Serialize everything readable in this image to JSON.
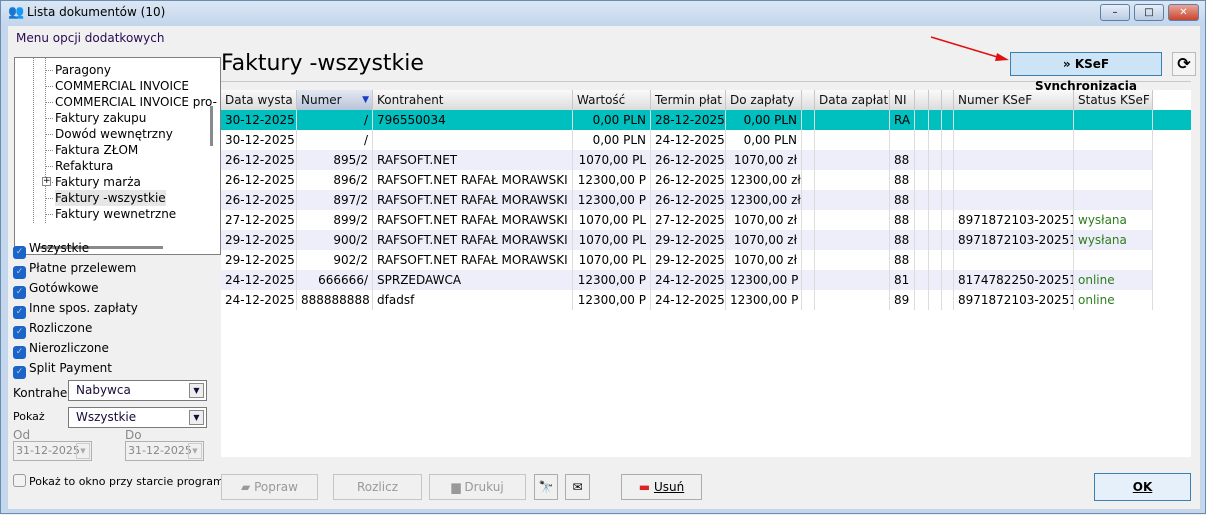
{
  "window": {
    "title": "Lista dokumentów (10)",
    "minimize": "–",
    "maximize": "□",
    "close": "✕"
  },
  "menu": "Menu opcji dodatkowych",
  "tree": {
    "items": [
      "Paragony",
      "COMMERCIAL INVOICE",
      "COMMERCIAL INVOICE pro-",
      "Faktury zakupu",
      "Dowód wewnętrzny",
      "Faktura ZŁOM",
      "Refaktura",
      "Faktury marża",
      "Faktury -wszystkie",
      "Faktury wewnetrzne"
    ],
    "selected": "Faktury -wszystkie",
    "expand": "+"
  },
  "filters": [
    {
      "label": "Wszystkie",
      "checked": true
    },
    {
      "label": "Płatne przelewem",
      "checked": true
    },
    {
      "label": "Gotówkowe",
      "checked": true
    },
    {
      "label": "Inne spos. zapłaty",
      "checked": true
    },
    {
      "label": "Rozliczone",
      "checked": true
    },
    {
      "label": "Nierozliczone",
      "checked": true
    },
    {
      "label": "Split Payment",
      "checked": true
    }
  ],
  "kontrahent": {
    "label": "Kontrahent",
    "value": "Nabywca"
  },
  "pokaz": {
    "label": "Pokaż",
    "value": "Wszystkie"
  },
  "od": {
    "label": "Od",
    "value": "31-12-2025"
  },
  "do": {
    "label": "Do",
    "value": "31-12-2025"
  },
  "startup_checkbox": {
    "label": "Pokaż to okno przy starcie programu",
    "checked": false
  },
  "page_title": "Faktury -wszystkie",
  "ksef_button": "» KSeF Synchronizacja",
  "columns": [
    "Data wysta",
    "Numer",
    "Kontrahent",
    "Wartość",
    "Termin płat",
    "Do zapłaty",
    "",
    "Data zapłat",
    "NI",
    "",
    "",
    "",
    "Numer KSeF",
    "Status KSeF"
  ],
  "sorted_column": "Numer",
  "rows": [
    [
      "30-12-2025",
      "/",
      "796550034",
      "0,00 PLN",
      "28-12-2025",
      "0,00 PLN",
      "",
      "",
      "RA",
      "",
      "",
      "",
      "",
      ""
    ],
    [
      "30-12-2025",
      "/",
      "",
      "0,00 PLN",
      "24-12-2025",
      "0,00 PLN",
      "",
      "",
      "",
      "",
      "",
      "",
      "",
      ""
    ],
    [
      "26-12-2025",
      "895/2",
      "RAFSOFT.NET",
      "1070,00 PL",
      "26-12-2025",
      "1070,00 zł",
      "",
      "",
      "88",
      "",
      "",
      "",
      "",
      ""
    ],
    [
      "26-12-2025",
      "896/2",
      "RAFSOFT.NET RAFAŁ MORAWSKI",
      "12300,00 P",
      "26-12-2025",
      "12300,00 zł",
      "",
      "",
      "88",
      "",
      "",
      "",
      "",
      ""
    ],
    [
      "26-12-2025",
      "897/2",
      "RAFSOFT.NET RAFAŁ MORAWSKI",
      "12300,00 P",
      "26-12-2025",
      "12300,00 zł",
      "",
      "",
      "88",
      "",
      "",
      "",
      "",
      ""
    ],
    [
      "27-12-2025",
      "899/2",
      "RAFSOFT.NET RAFAŁ MORAWSKI",
      "1070,00 PL",
      "27-12-2025",
      "1070,00 zł",
      "",
      "",
      "88",
      "",
      "",
      "",
      "8971872103-20251",
      "wysłana"
    ],
    [
      "29-12-2025",
      "900/2",
      "RAFSOFT.NET RAFAŁ MORAWSKI",
      "1070,00 PL",
      "29-12-2025",
      "1070,00 zł",
      "",
      "",
      "88",
      "",
      "",
      "",
      "8971872103-20251",
      "wysłana"
    ],
    [
      "29-12-2025",
      "902/2",
      "RAFSOFT.NET RAFAŁ MORAWSKI",
      "1070,00 PL",
      "29-12-2025",
      "1070,00 zł",
      "",
      "",
      "88",
      "",
      "",
      "",
      "",
      ""
    ],
    [
      "24-12-2025",
      "666666/",
      "SPRZEDAWCA",
      "12300,00 P",
      "24-12-2025",
      "12300,00 P",
      "",
      "",
      "81",
      "",
      "",
      "",
      "8174782250-20251",
      "online"
    ],
    [
      "24-12-2025",
      "888888888",
      "dfadsf",
      "12300,00 P",
      "24-12-2025",
      "12300,00 P",
      "",
      "",
      "89",
      "",
      "",
      "",
      "8971872103-20251",
      "online"
    ]
  ],
  "selected_row": 0,
  "buttons": {
    "popraw": "Popraw",
    "rozlicz": "Rozlicz",
    "drukuj": "Drukuj",
    "usun": "Usuń",
    "ok": "OK"
  },
  "colors": {
    "selected_row": "#00bfbf",
    "alt_row": "#eeeefa",
    "status": "#2f7d1e",
    "ksef_button": "#cde4f7"
  }
}
